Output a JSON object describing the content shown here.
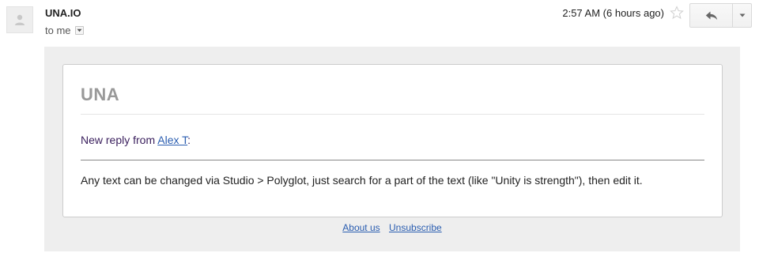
{
  "header": {
    "sender": "UNA.IO",
    "recipient": "to me",
    "timestamp": "2:57 AM (6 hours ago)"
  },
  "icons": {
    "avatar": "person-icon",
    "dropdown": "caret-down-icon",
    "star": "star-outline-icon",
    "reply": "reply-arrow-icon",
    "more": "caret-down-icon"
  },
  "email": {
    "brand": "UNA",
    "reply_prefix": "New reply from ",
    "reply_author": "Alex T",
    "reply_suffix": ":",
    "message": "Any text can be changed via Studio > Polyglot, just search for a part of the text (like \"Unity is strength\"), then edit it.",
    "footer": {
      "about_label": "About us",
      "unsubscribe_label": "Unsubscribe"
    }
  },
  "colors": {
    "link": "#2a5db0",
    "brand_gray": "#999999",
    "reply_text": "#3a1f5d",
    "mail_background": "#eeeeee"
  }
}
